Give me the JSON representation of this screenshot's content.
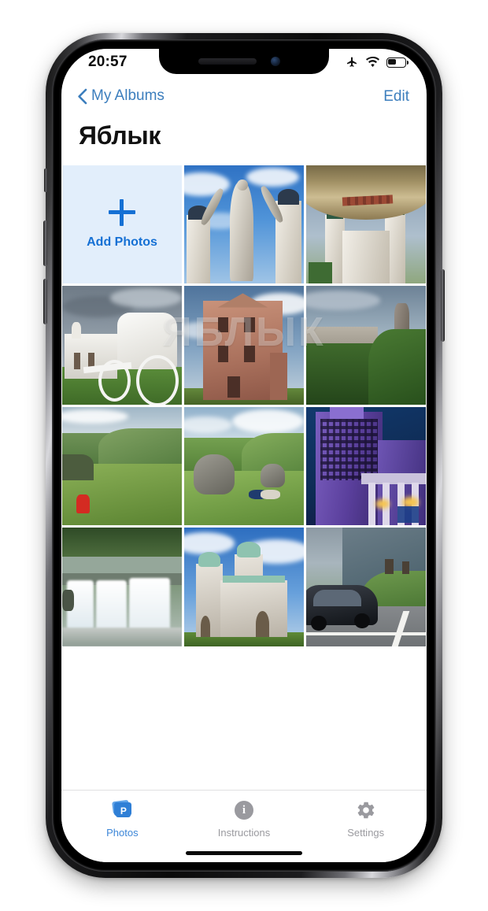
{
  "statusbar": {
    "time": "20:57",
    "icons": [
      "airplane-mode-icon",
      "wifi-icon",
      "battery-icon"
    ],
    "battery_level_percent": 45
  },
  "navbar": {
    "back_label": "My Albums",
    "back_icon": "chevron-left-icon",
    "edit_label": "Edit"
  },
  "page_title": "Яблык",
  "watermark": "ЯБЛЫК",
  "add_photos": {
    "label": "Add Photos",
    "icon": "plus-icon"
  },
  "colors": {
    "accent": "#3c7ebd",
    "add_cell_bg": "#e2eefb",
    "add_cell_fg": "#1570d4",
    "tab_active": "#3c86d8",
    "tab_inactive": "#9a9a9f"
  },
  "photos": [
    {
      "id": "photo-1",
      "caption": "Statue with raised arms before twin church towers"
    },
    {
      "id": "photo-2",
      "caption": "Baroque church framed by stone arch"
    },
    {
      "id": "photo-3",
      "caption": "White manor house with horse carriage"
    },
    {
      "id": "photo-4",
      "caption": "Brick ruins of palace facade"
    },
    {
      "id": "photo-5",
      "caption": "Rock pinnacle above green forested valley"
    },
    {
      "id": "photo-6",
      "caption": "Hiker in red jacket on grassy mountain slope"
    },
    {
      "id": "photo-7",
      "caption": "Boulders on green hillside meadow"
    },
    {
      "id": "photo-8",
      "caption": "Purple-lit high-rise tower at night"
    },
    {
      "id": "photo-9",
      "caption": "Long exposure waterfall in forest"
    },
    {
      "id": "photo-10",
      "caption": "Stone cathedral with green domes"
    },
    {
      "id": "photo-11",
      "caption": "Black SUV parked before mountain church"
    }
  ],
  "tabbar": {
    "items": [
      {
        "label": "Photos",
        "icon": "photos-stack-icon",
        "active": true
      },
      {
        "label": "Instructions",
        "icon": "info-circle-icon",
        "active": false
      },
      {
        "label": "Settings",
        "icon": "gear-icon",
        "active": false
      }
    ]
  }
}
